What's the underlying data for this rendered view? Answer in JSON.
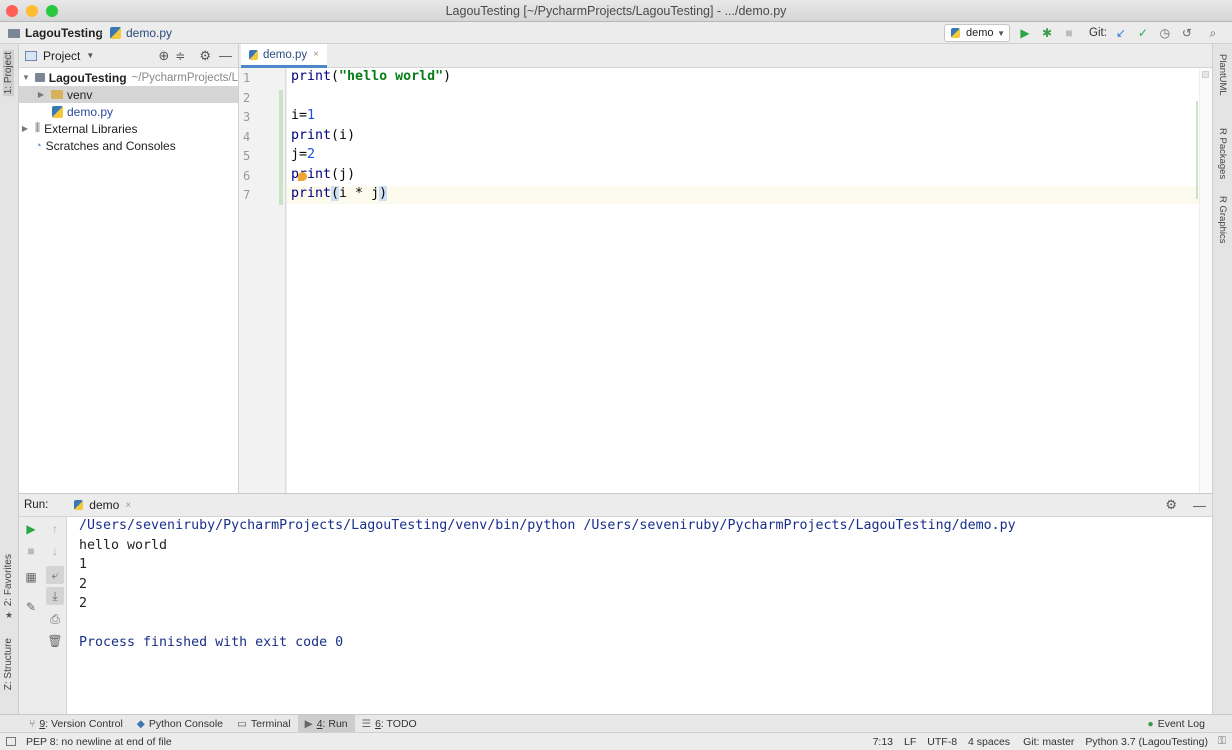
{
  "window": {
    "title": "LagouTesting [~/PycharmProjects/LagouTesting] - .../demo.py",
    "traffic_colors": [
      "#fe5f57",
      "#febc2e",
      "#28c840"
    ]
  },
  "nav": {
    "project": "LagouTesting",
    "file": "demo.py",
    "run_config": "demo",
    "git_label": "Git:"
  },
  "left_strip": {
    "project_tab": "1: Project",
    "favorites_tab": "2: Favorites",
    "structure_tab": "Z: Structure"
  },
  "right_strip": {
    "tabs": [
      "PlantUML",
      "R Packages",
      "R Graphics"
    ]
  },
  "project_panel": {
    "header": "Project",
    "root_name": "LagouTesting",
    "root_path": "~/PycharmProjects/L",
    "venv": "venv",
    "file": "demo.py",
    "external": "External Libraries",
    "scratches": "Scratches and Consoles"
  },
  "editor": {
    "tab_label": "demo.py",
    "line_numbers": [
      "1",
      "2",
      "3",
      "4",
      "5",
      "6",
      "7"
    ],
    "lines": [
      {
        "fn": "print",
        "open": "(",
        "arg": "\"hello world\"",
        "close": ")"
      },
      {
        "fn": "",
        "open": "",
        "arg": "",
        "close": ""
      },
      {
        "fn": "i=",
        "open": "",
        "arg": "1",
        "close": ""
      },
      {
        "fn": "print",
        "open": "(",
        "arg": "i",
        "close": ")"
      },
      {
        "fn": "j=",
        "open": "",
        "arg": "2",
        "close": ""
      },
      {
        "fn": "print",
        "open": "(",
        "arg": "j",
        "close": ")"
      },
      {
        "fn": "print",
        "open": "(",
        "arg": "i * j",
        "close": ")"
      }
    ]
  },
  "run": {
    "label": "Run:",
    "tab": "demo",
    "console": [
      "/Users/seveniruby/PycharmProjects/LagouTesting/venv/bin/python /Users/seveniruby/PycharmProjects/LagouTesting/demo.py",
      "hello world",
      "1",
      "2",
      "2",
      "",
      "Process finished with exit code 0"
    ]
  },
  "toolwindows": [
    {
      "num": "9",
      "label": ": Version Control"
    },
    {
      "num": "",
      "label": "Python Console"
    },
    {
      "num": "",
      "label": "Terminal"
    },
    {
      "num": "4",
      "label": ": Run"
    },
    {
      "num": "6",
      "label": ": TODO"
    }
  ],
  "event_log": "Event Log",
  "status": {
    "message": "PEP 8: no newline at end of file",
    "position": "7:13",
    "line_sep": "LF",
    "encoding": "UTF-8",
    "indent": "4 spaces",
    "git": "Git: master",
    "interpreter": "Python 3.7 (LagouTesting)"
  }
}
